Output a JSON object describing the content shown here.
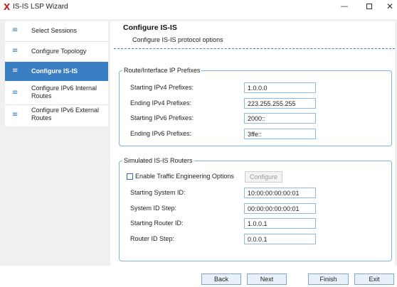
{
  "window": {
    "logo": "X",
    "title": "IS-IS LSP Wizard",
    "minimize": "—",
    "close": "✕"
  },
  "sidebar": {
    "items": [
      {
        "icon": "≡",
        "label": "Select Sessions",
        "active": false
      },
      {
        "icon": "≡",
        "label": "Configure Topology",
        "active": false
      },
      {
        "icon": "≡",
        "label": "Configure IS-IS",
        "active": true
      },
      {
        "icon": "≡",
        "label": "Configure IPv6 Internal Routes",
        "active": false
      },
      {
        "icon": "≡",
        "label": "Configure IPv6 External Routes",
        "active": false
      }
    ]
  },
  "main": {
    "title": "Configure IS-IS",
    "subtitle": "Configure IS-IS protocol options"
  },
  "prefixes": {
    "legend": "Route/Interface IP Prefixes",
    "fields": [
      {
        "label": "Starting IPv4 Prefixes:",
        "value": "1.0.0.0"
      },
      {
        "label": "Ending IPv4 Prefixes:",
        "value": "223.255.255.255"
      },
      {
        "label": "Starting IPv6 Prefixes:",
        "value": "2000::"
      },
      {
        "label": "Ending IPv6 Prefixes:",
        "value": "3ffe::"
      }
    ]
  },
  "routers": {
    "legend": "Simulated IS-IS Routers",
    "te_label": "Enable Traffic Engineering Options",
    "te_checked": false,
    "configure_label": "Configure",
    "fields": [
      {
        "label": "Starting System ID:",
        "value": "10:00:00:00:00:01"
      },
      {
        "label": "System ID Step:",
        "value": "00:00:00:00:00:01"
      },
      {
        "label": "Starting Router ID:",
        "value": "1.0.0.1"
      },
      {
        "label": "Router ID Step:",
        "value": "0.0.0.1"
      }
    ]
  },
  "footer": {
    "back": "Back",
    "next": "Next",
    "finish": "Finish",
    "exit": "Exit"
  },
  "colors": {
    "accent": "#3a7ec3",
    "logo": "#c0282d",
    "border": "#7fb2df"
  }
}
